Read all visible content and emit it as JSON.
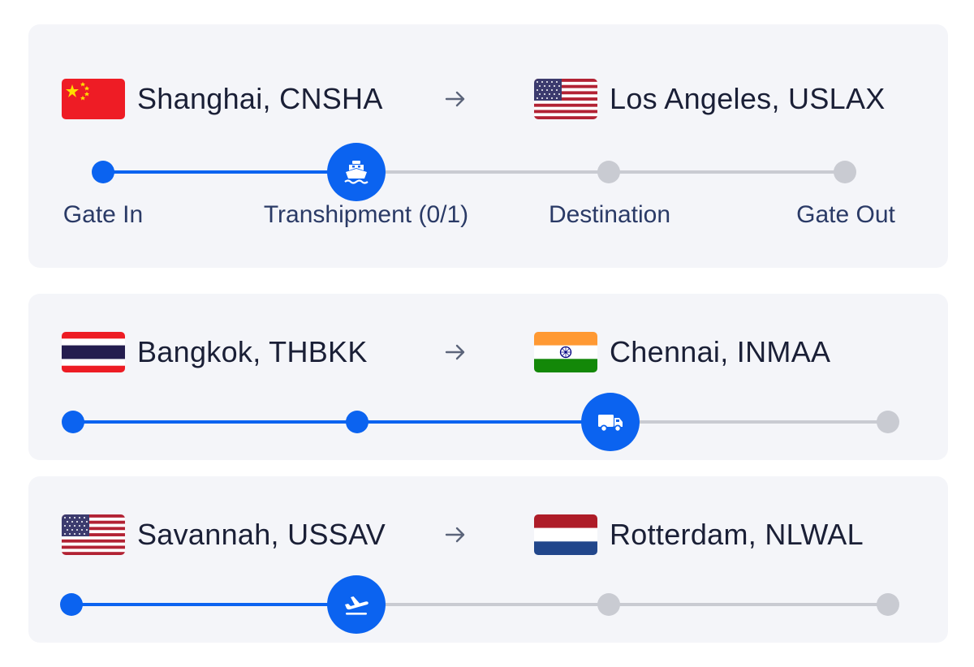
{
  "colors": {
    "progress": "#0b63f0",
    "pending": "#c9cbd2",
    "card_background": "#f4f5f9",
    "port_text": "#1a1f36",
    "stage_text": "#2a3a66"
  },
  "shipments": [
    {
      "origin": {
        "flag_icon": "china-flag-icon",
        "label": "Shanghai, CNSHA"
      },
      "destination": {
        "flag_icon": "usa-flag-icon",
        "label": "Los Angeles, USLAX"
      },
      "direction_icon": "arrow-right-icon",
      "stages": [
        "Gate In",
        "Transhipment (0/1)",
        "Destination",
        "Gate Out"
      ],
      "current_mode_icon": "ship-icon",
      "progress_stops_completed": 2,
      "total_stops": 4
    },
    {
      "origin": {
        "flag_icon": "thailand-flag-icon",
        "label": "Bangkok, THBKK"
      },
      "destination": {
        "flag_icon": "india-flag-icon",
        "label": "Chennai, INMAA"
      },
      "direction_icon": "arrow-right-icon",
      "current_mode_icon": "truck-icon",
      "progress_stops_completed": 3,
      "total_stops": 4
    },
    {
      "origin": {
        "flag_icon": "usa-flag-icon",
        "label": "Savannah, USSAV"
      },
      "destination": {
        "flag_icon": "netherlands-flag-icon",
        "label": "Rotterdam, NLWAL"
      },
      "direction_icon": "arrow-right-icon",
      "current_mode_icon": "airplane-departure-icon",
      "progress_stops_completed": 2,
      "total_stops": 4
    }
  ]
}
